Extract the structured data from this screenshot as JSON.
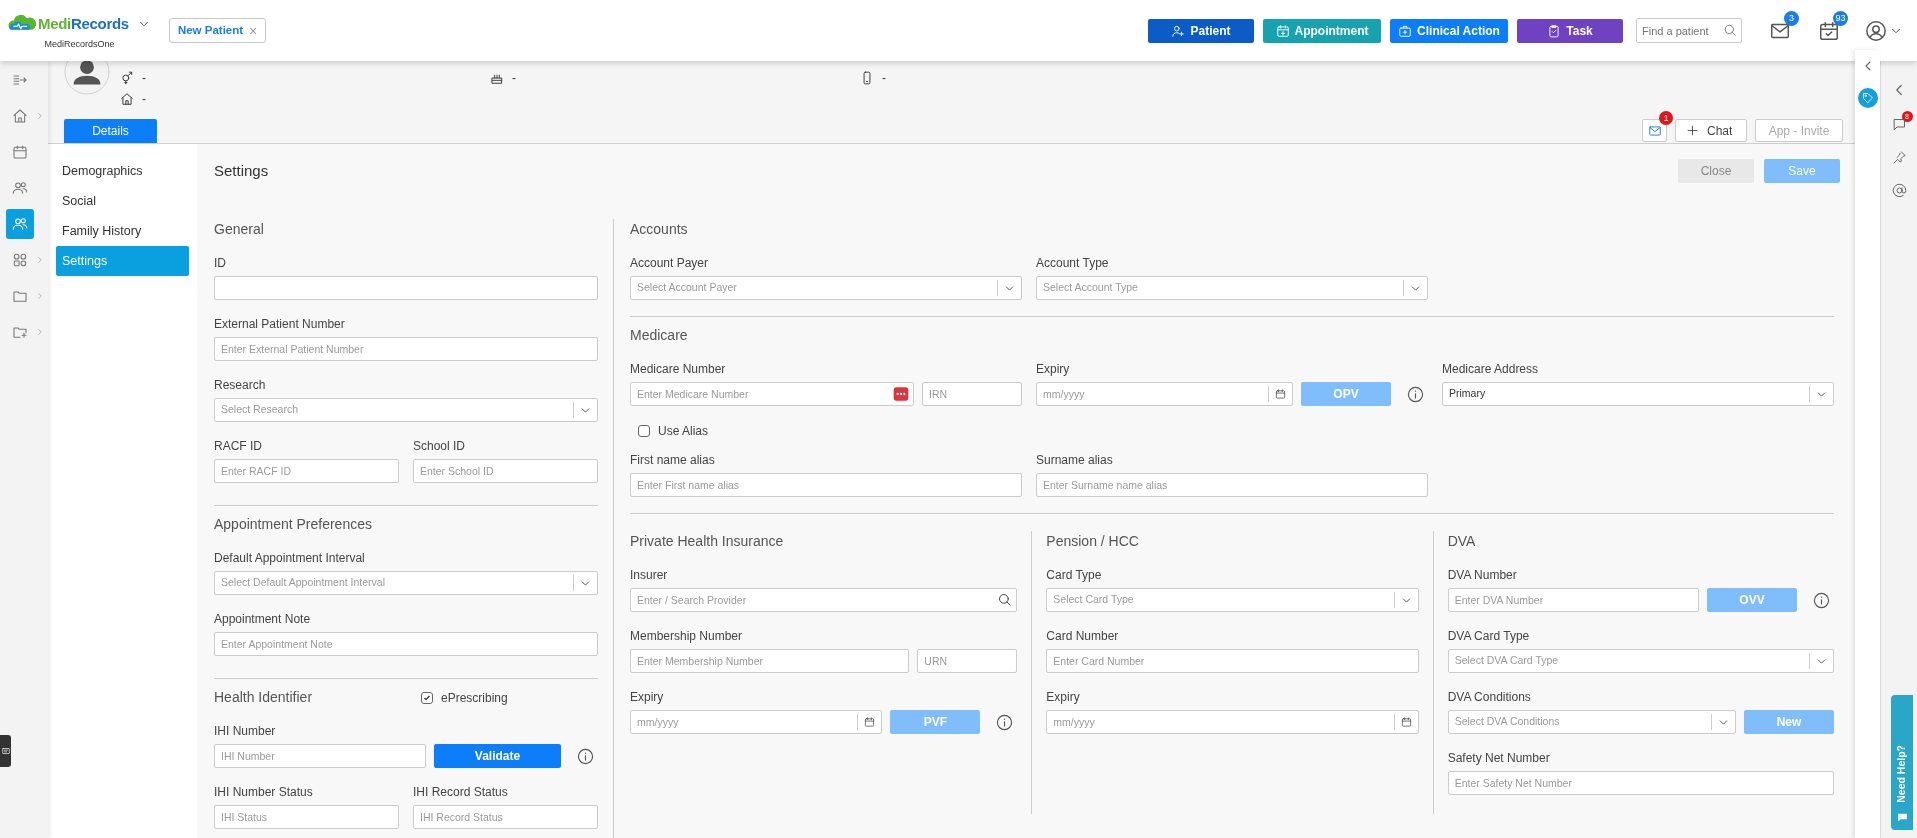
{
  "header": {
    "brand": {
      "parts": [
        {
          "text": "Medi",
          "color": "#5cb531"
        },
        {
          "text": "Records",
          "color": "#1b72c4"
        }
      ],
      "subtitle": "MediRecordsOne"
    },
    "open_tab": {
      "label": "New Patient",
      "close": "×"
    },
    "actions": [
      {
        "label": "Patient",
        "kind": "patient",
        "color": "#0b5cc7"
      },
      {
        "label": "Appointment",
        "kind": "appointment",
        "color": "#17a2b0"
      },
      {
        "label": "Clinical Action",
        "kind": "clinical",
        "color": "#0d7ef9"
      },
      {
        "label": "Task",
        "kind": "task",
        "color": "#6f42c1"
      }
    ],
    "search": {
      "placeholder": "Find a patient"
    },
    "notifications": [
      {
        "kind": "mail",
        "badge": "3"
      },
      {
        "kind": "tasks",
        "badge": "93"
      }
    ]
  },
  "rail": [
    {
      "kind": "collapse",
      "submenu": false,
      "selected": false
    },
    {
      "kind": "home",
      "submenu": true,
      "selected": false
    },
    {
      "kind": "calendar",
      "submenu": false,
      "selected": false
    },
    {
      "kind": "contacts",
      "submenu": false,
      "selected": false
    },
    {
      "kind": "patients",
      "submenu": false,
      "selected": true
    },
    {
      "kind": "apps",
      "submenu": true,
      "selected": false
    },
    {
      "kind": "folder",
      "submenu": true,
      "selected": false
    },
    {
      "kind": "folder-add",
      "submenu": true,
      "selected": false
    }
  ],
  "patient": {
    "fields": [
      {
        "kind": "gender",
        "value": "-"
      },
      {
        "kind": "address",
        "value": "-"
      },
      {
        "kind": "birthday",
        "value": "-"
      },
      {
        "kind": "phone",
        "value": "-"
      }
    ]
  },
  "tabs": [
    {
      "label": "Details",
      "selected": true
    }
  ],
  "toolbar": {
    "mail_badge": "1",
    "chat": {
      "label": "Chat",
      "disabled": false
    },
    "invite": {
      "label": "App - Invite",
      "disabled": true
    }
  },
  "subnav": [
    {
      "label": "Demographics",
      "selected": false
    },
    {
      "label": "Social",
      "selected": false
    },
    {
      "label": "Family History",
      "selected": false
    },
    {
      "label": "Settings",
      "selected": true
    }
  ],
  "page": {
    "title": "Settings",
    "buttons": [
      {
        "label": "Close",
        "kind": "secondary",
        "disabled": false
      },
      {
        "label": "Save",
        "kind": "primary",
        "disabled": true
      }
    ]
  },
  "left_sections": [
    {
      "title": "General",
      "rows": [
        [
          {
            "label": "ID",
            "controls": [
              {
                "kind": "text"
              }
            ]
          }
        ],
        [
          {
            "label": "External Patient Number",
            "controls": [
              {
                "kind": "text",
                "placeholder": "Enter External Patient Number"
              }
            ]
          }
        ],
        [
          {
            "label": "Research",
            "controls": [
              {
                "kind": "select",
                "placeholder": "Select Research"
              }
            ]
          }
        ],
        [
          {
            "label": "RACF ID",
            "controls": [
              {
                "kind": "text",
                "placeholder": "Enter RACF ID"
              }
            ]
          },
          {
            "label": "School ID",
            "controls": [
              {
                "kind": "text",
                "placeholder": "Enter School ID"
              }
            ]
          }
        ]
      ]
    },
    {
      "title": "Appointment Preferences",
      "rows": [
        [
          {
            "label": "Default Appointment Interval",
            "controls": [
              {
                "kind": "select",
                "placeholder": "Select Default Appointment Interval"
              }
            ]
          }
        ],
        [
          {
            "label": "Appointment Note",
            "controls": [
              {
                "kind": "text",
                "placeholder": "Enter Appointment Note"
              }
            ]
          }
        ]
      ]
    },
    {
      "title": "Health Identifier",
      "checkbox": {
        "label": "ePrescribing",
        "checked": true
      },
      "rows": [
        [
          {
            "label": "IHI Number",
            "controls": [
              {
                "kind": "text",
                "placeholder": "IHI Number"
              },
              {
                "kind": "button",
                "label": "Validate",
                "disabled": false
              },
              {
                "kind": "info"
              }
            ]
          }
        ],
        [
          {
            "label": "IHI Number Status",
            "controls": [
              {
                "kind": "text",
                "placeholder": "IHI Status"
              }
            ]
          },
          {
            "label": "IHI Record Status",
            "controls": [
              {
                "kind": "text",
                "placeholder": "IHI Record Status"
              }
            ]
          }
        ]
      ]
    }
  ],
  "right_sections": [
    {
      "title": "Accounts",
      "rows": [
        [
          {
            "label": "Account Payer",
            "controls": [
              {
                "kind": "select",
                "placeholder": "Select Account Payer"
              }
            ]
          },
          {
            "label": "Account Type",
            "controls": [
              {
                "kind": "select",
                "placeholder": "Select Account Type"
              }
            ]
          }
        ]
      ]
    },
    {
      "title": "Medicare",
      "rows": [
        [
          {
            "label": "Medicare Number",
            "controls": [
              {
                "kind": "medicare",
                "placeholder": "Enter Medicare Number"
              },
              {
                "kind": "short",
                "placeholder": "IRN"
              }
            ]
          },
          {
            "label": "Expiry",
            "controls": [
              {
                "kind": "date",
                "placeholder": "mm/yyyy"
              },
              {
                "kind": "button",
                "label": "OPV",
                "disabled": true
              },
              {
                "kind": "info"
              }
            ]
          },
          {
            "label": "Medicare Address",
            "controls": [
              {
                "kind": "select",
                "value": "Primary"
              }
            ]
          }
        ],
        [
          {
            "controls": [
              {
                "kind": "checkbox",
                "label": "Use Alias",
                "checked": false
              }
            ]
          }
        ],
        [
          {
            "label": "First name alias",
            "controls": [
              {
                "kind": "text",
                "placeholder": "Enter First name alias"
              }
            ]
          },
          {
            "label": "Surname alias",
            "controls": [
              {
                "kind": "text",
                "placeholder": "Enter Surname name alias"
              }
            ]
          }
        ]
      ]
    }
  ],
  "right_columns": [
    {
      "title": "Private Health Insurance",
      "rows": [
        [
          {
            "label": "Insurer",
            "controls": [
              {
                "kind": "search",
                "placeholder": "Enter / Search Provider"
              }
            ]
          }
        ],
        [
          {
            "label": "Membership Number",
            "controls": [
              {
                "kind": "text",
                "placeholder": "Enter Membership Number"
              },
              {
                "kind": "short",
                "placeholder": "URN"
              }
            ]
          }
        ],
        [
          {
            "label": "Expiry",
            "controls": [
              {
                "kind": "date",
                "placeholder": "mm/yyyy"
              },
              {
                "kind": "button",
                "label": "PVF",
                "disabled": true
              },
              {
                "kind": "info"
              }
            ]
          }
        ]
      ]
    },
    {
      "title": "Pension / HCC",
      "rows": [
        [
          {
            "label": "Card Type",
            "controls": [
              {
                "kind": "select",
                "placeholder": "Select Card Type"
              }
            ]
          }
        ],
        [
          {
            "label": "Card Number",
            "controls": [
              {
                "kind": "text",
                "placeholder": "Enter Card Number"
              }
            ]
          }
        ],
        [
          {
            "label": "Expiry",
            "controls": [
              {
                "kind": "date",
                "placeholder": "mm/yyyy"
              }
            ]
          }
        ]
      ]
    },
    {
      "title": "DVA",
      "rows": [
        [
          {
            "label": "DVA Number",
            "controls": [
              {
                "kind": "text",
                "placeholder": "Enter DVA Number"
              },
              {
                "kind": "button",
                "label": "OVV",
                "disabled": true
              },
              {
                "kind": "info"
              }
            ]
          }
        ],
        [
          {
            "label": "DVA Card Type",
            "controls": [
              {
                "kind": "select",
                "placeholder": "Select DVA Card Type"
              }
            ]
          }
        ],
        [
          {
            "label": "DVA Conditions",
            "controls": [
              {
                "kind": "select",
                "placeholder": "Select DVA Conditions"
              },
              {
                "kind": "button",
                "label": "New",
                "disabled": true
              }
            ]
          }
        ],
        [
          {
            "label": "Safety Net Number",
            "controls": [
              {
                "kind": "text",
                "placeholder": "Enter Safety Net Number"
              }
            ]
          }
        ]
      ]
    }
  ],
  "side_panel": {
    "chat_badge": "8",
    "help": "Need Help?"
  }
}
